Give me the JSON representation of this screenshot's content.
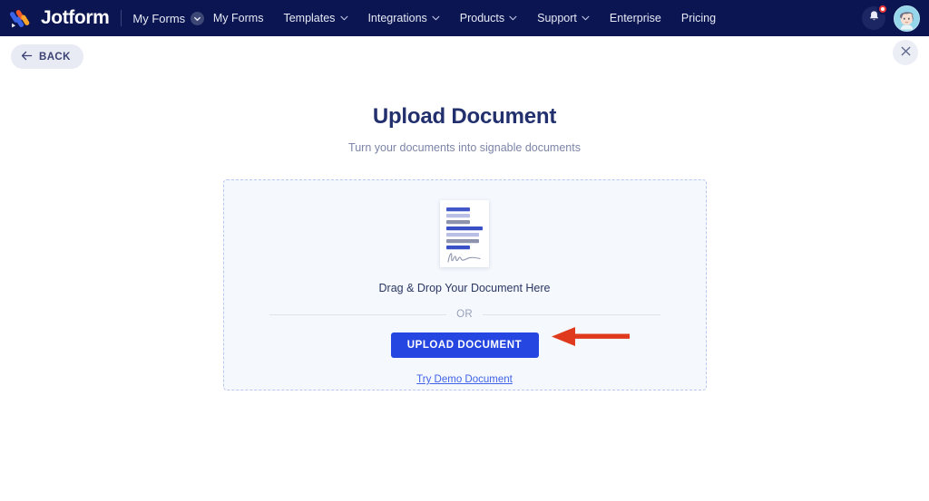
{
  "header": {
    "brand_name": "Jotform",
    "logo_icon": "jotform-logo-icon",
    "my_forms_label": "My Forms",
    "my_forms_badge_icon": "chevron-down-circle-icon",
    "nav_items": [
      {
        "label": "My Forms",
        "has_chevron": false,
        "icon": ""
      },
      {
        "label": "Templates",
        "has_chevron": true,
        "icon": "chevron-down-icon"
      },
      {
        "label": "Integrations",
        "has_chevron": true,
        "icon": "chevron-down-icon"
      },
      {
        "label": "Products",
        "has_chevron": true,
        "icon": "chevron-down-icon"
      },
      {
        "label": "Support",
        "has_chevron": true,
        "icon": "chevron-down-icon"
      },
      {
        "label": "Enterprise",
        "has_chevron": false,
        "icon": ""
      },
      {
        "label": "Pricing",
        "has_chevron": false,
        "icon": ""
      }
    ],
    "notification_icon": "bell-icon",
    "notification_badge": "",
    "avatar_icon": "user-avatar",
    "bg_color": "#0a1551"
  },
  "toolbar": {
    "back_label": "BACK",
    "back_icon": "arrow-left-icon",
    "close_icon": "close-icon"
  },
  "main": {
    "title": "Upload Document",
    "subtitle": "Turn your documents into signable documents",
    "dropzone": {
      "doc_icon": "document-with-signature-icon",
      "drag_label": "Drag & Drop Your Document Here",
      "or_label": "OR",
      "upload_button_label": "UPLOAD DOCUMENT",
      "demo_link_label": "Try Demo Document",
      "border_color": "#b9c6f0",
      "bg_color": "#f5f8fd"
    }
  },
  "annotation": {
    "arrow_icon": "red-arrow-left-icon",
    "color": "#e03a1e"
  }
}
